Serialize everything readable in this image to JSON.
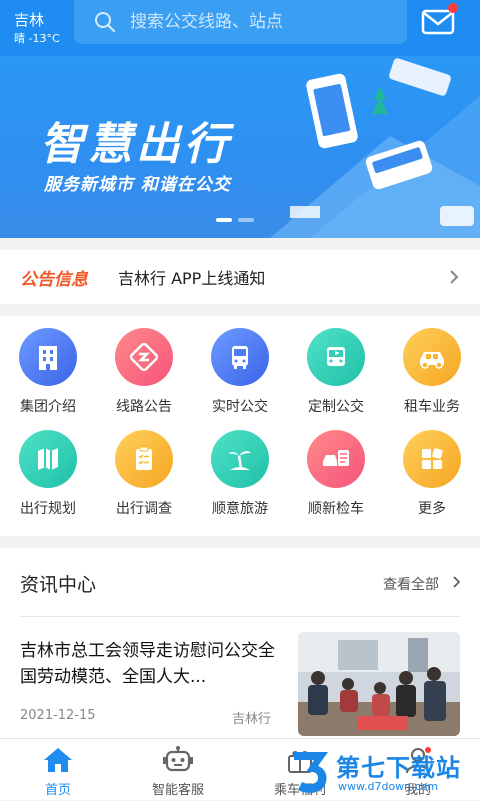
{
  "header": {
    "city": "吉林",
    "weather": "晴 -13°C",
    "search_placeholder": "搜索公交线路、站点",
    "mail_icon": "mail-icon",
    "accent_color": "#1e8cf0"
  },
  "banner": {
    "title": "智慧出行",
    "subtitle": "服务新城市 和谐在公交",
    "slides": 2,
    "active_slide": 1
  },
  "notice": {
    "tag": "公告信息",
    "text": "吉林行 APP上线通知"
  },
  "grid": {
    "items": [
      {
        "label": "集团介绍",
        "icon": "building-icon",
        "color": "#4f7df5"
      },
      {
        "label": "线路公告",
        "icon": "route-icon",
        "color": "#f76b7b"
      },
      {
        "label": "实时公交",
        "icon": "bus-icon",
        "color": "#4f7df5"
      },
      {
        "label": "定制公交",
        "icon": "custom-bus-icon",
        "color": "#2fcfb8"
      },
      {
        "label": "租车业务",
        "icon": "car-icon",
        "color": "#f9b82a"
      },
      {
        "label": "出行规划",
        "icon": "map-icon",
        "color": "#2fcfb8"
      },
      {
        "label": "出行调查",
        "icon": "survey-icon",
        "color": "#f9b82a"
      },
      {
        "label": "顺意旅游",
        "icon": "palm-tree-icon",
        "color": "#2fcfb8"
      },
      {
        "label": "顺新检车",
        "icon": "car-check-icon",
        "color": "#f76b7b"
      },
      {
        "label": "更多",
        "icon": "more-grid-icon",
        "color": "#f9b82a"
      }
    ]
  },
  "news": {
    "heading": "资讯中心",
    "more_label": "查看全部",
    "article": {
      "title": "吉林市总工会领导走访慰问公交全国劳动模范、全国人大...",
      "date": "2021-12-15",
      "source": "吉林行"
    }
  },
  "tabbar": {
    "items": [
      {
        "label": "首页",
        "icon": "home-icon",
        "active": true
      },
      {
        "label": "智能客服",
        "icon": "robot-icon",
        "active": false
      },
      {
        "label": "乘车福利",
        "icon": "gift-icon",
        "active": false
      },
      {
        "label": "我的",
        "icon": "user-icon",
        "active": false
      }
    ]
  },
  "watermark": {
    "text": "第七下载站",
    "url": "www.d7down.com"
  }
}
